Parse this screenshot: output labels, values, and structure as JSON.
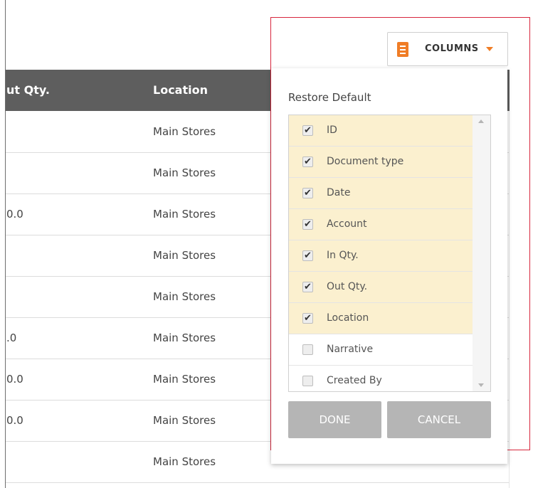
{
  "table": {
    "headers": [
      "ut Qty.",
      "Location"
    ],
    "rows": [
      {
        "qty": "",
        "location": "Main Stores"
      },
      {
        "qty": "",
        "location": "Main Stores"
      },
      {
        "qty": "0.0",
        "location": "Main Stores"
      },
      {
        "qty": "",
        "location": "Main Stores"
      },
      {
        "qty": "",
        "location": "Main Stores"
      },
      {
        "qty": ".0",
        "location": "Main Stores"
      },
      {
        "qty": "0.0",
        "location": "Main Stores"
      },
      {
        "qty": "0.0",
        "location": "Main Stores"
      },
      {
        "qty": "",
        "location": "Main Stores"
      }
    ]
  },
  "columns_button": {
    "label": "COLUMNS",
    "icon": "columns-icon",
    "caret_icon": "caret-down-icon",
    "accent": "#f07d26"
  },
  "panel": {
    "restore_label": "Restore Default",
    "items": [
      {
        "label": "ID",
        "checked": true
      },
      {
        "label": "Document type",
        "checked": true
      },
      {
        "label": "Date",
        "checked": true
      },
      {
        "label": "Account",
        "checked": true
      },
      {
        "label": "In Qty.",
        "checked": true
      },
      {
        "label": "Out Qty.",
        "checked": true
      },
      {
        "label": "Location",
        "checked": true
      },
      {
        "label": "Narrative",
        "checked": false
      },
      {
        "label": "Created By",
        "checked": false
      }
    ],
    "done_label": "DONE",
    "cancel_label": "CANCEL"
  },
  "colors": {
    "header_bg": "#5e5e5e",
    "highlight_border": "#d7263d",
    "checked_bg": "#fbf0cf",
    "button_bg": "#b5b5b5"
  }
}
